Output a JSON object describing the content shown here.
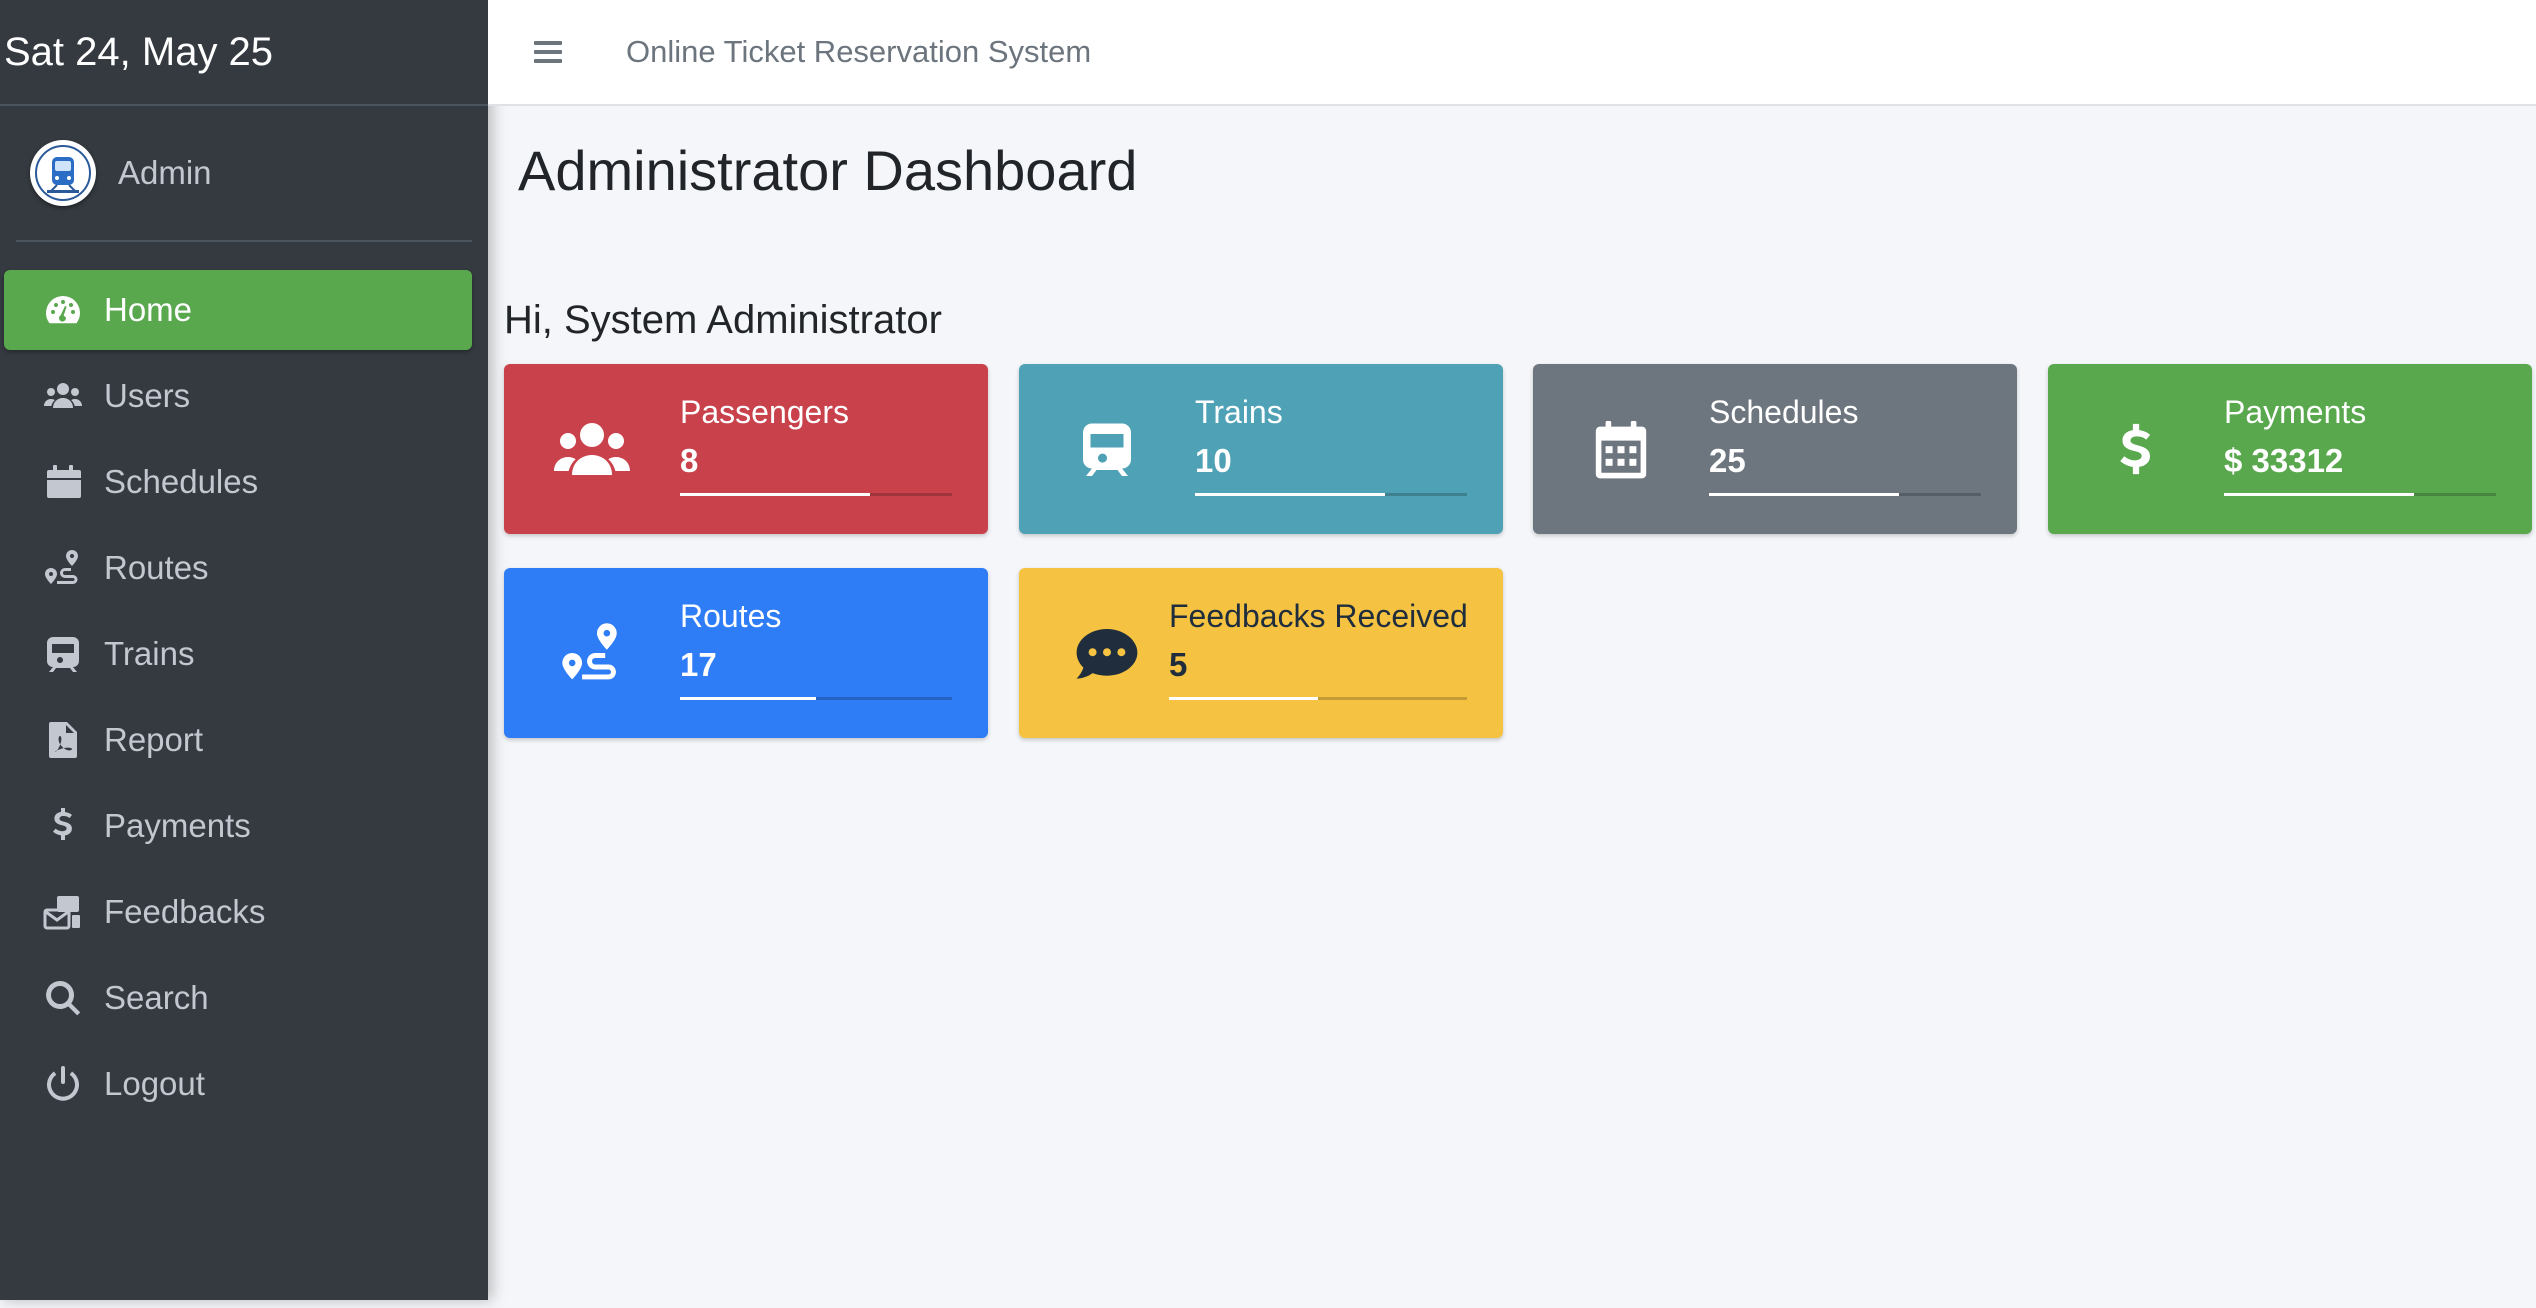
{
  "sidebar": {
    "date": "Sat 24, May 25",
    "user": "Admin",
    "items": [
      {
        "label": "Home",
        "icon": "tachometer-icon"
      },
      {
        "label": "Users",
        "icon": "users-icon"
      },
      {
        "label": "Schedules",
        "icon": "calendar-icon"
      },
      {
        "label": "Routes",
        "icon": "route-icon"
      },
      {
        "label": "Trains",
        "icon": "train-icon"
      },
      {
        "label": "Report",
        "icon": "file-pdf-icon"
      },
      {
        "label": "Payments",
        "icon": "dollar-icon"
      },
      {
        "label": "Feedbacks",
        "icon": "mail-bulk-icon"
      },
      {
        "label": "Search",
        "icon": "search-icon"
      },
      {
        "label": "Logout",
        "icon": "power-icon"
      }
    ],
    "active": "Home"
  },
  "header": {
    "menu_icon": "hamburger-icon",
    "app_title": "Online Ticket Reservation System"
  },
  "main": {
    "title": "Administrator Dashboard",
    "greeting": "Hi, System Administrator",
    "cards": [
      {
        "label": "Passengers",
        "value": "8",
        "icon": "users-icon",
        "color": "#c9414b",
        "progress": 0.7
      },
      {
        "label": "Trains",
        "value": "10",
        "icon": "train-icon",
        "color": "#4fa1b5",
        "progress": 0.7
      },
      {
        "label": "Schedules",
        "value": "25",
        "icon": "calendar-icon",
        "color": "#6d757e",
        "progress": 0.7
      },
      {
        "label": "Payments",
        "value": "$ 33312",
        "icon": "dollar-icon",
        "color": "#59a84e",
        "progress": 0.7
      },
      {
        "label": "Routes",
        "value": "17",
        "icon": "route-icon",
        "color": "#2e7cf6",
        "progress": 0.5
      },
      {
        "label": "Feedbacks Received",
        "value": "5",
        "icon": "comment-dots-icon",
        "color": "#f5c241",
        "progress": 0.5
      }
    ]
  }
}
